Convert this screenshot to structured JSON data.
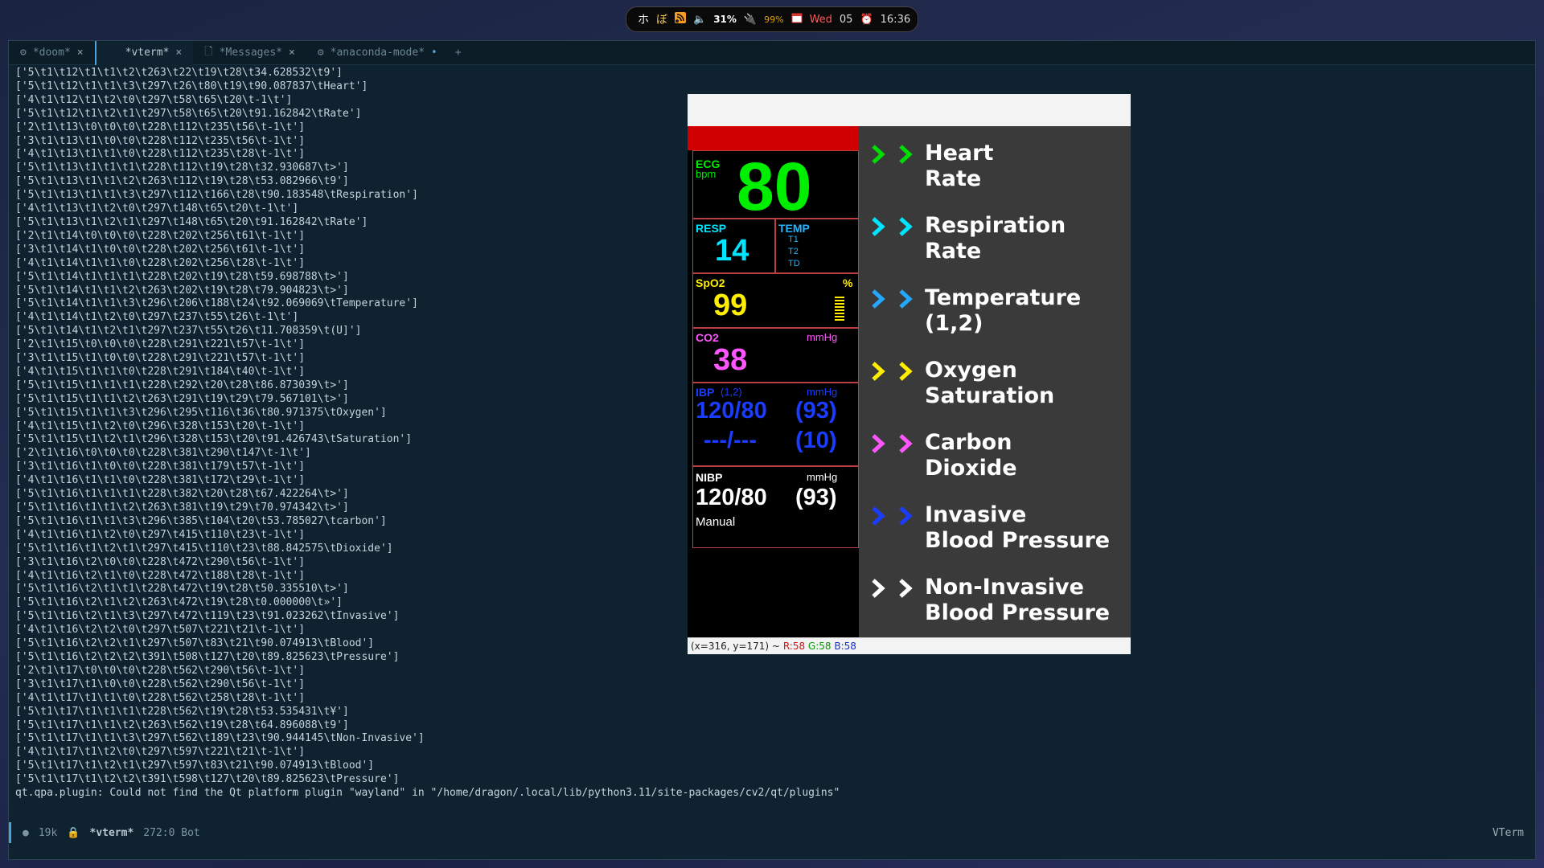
{
  "topbar": {
    "jp1": "ホ",
    "jp2": "ぼ",
    "volume": "31%",
    "battery": "99%",
    "day": "Wed",
    "date": "05",
    "time": "16:36"
  },
  "tabs": [
    {
      "label": "*doom*"
    },
    {
      "label": "*vterm*"
    },
    {
      "label": "*Messages*"
    },
    {
      "label": "*anaconda-mode*"
    }
  ],
  "terminal_lines": [
    "['5\\t1\\t12\\t1\\t1\\t2\\t263\\t22\\t19\\t28\\t34.628532\\t9']",
    "['5\\t1\\t12\\t1\\t1\\t3\\t297\\t26\\t80\\t19\\t90.087837\\tHeart']",
    "['4\\t1\\t12\\t1\\t2\\t0\\t297\\t58\\t65\\t20\\t-1\\t']",
    "['5\\t1\\t12\\t1\\t2\\t1\\t297\\t58\\t65\\t20\\t91.162842\\tRate']",
    "['2\\t1\\t13\\t0\\t0\\t0\\t228\\t112\\t235\\t56\\t-1\\t']",
    "['3\\t1\\t13\\t1\\t0\\t0\\t228\\t112\\t235\\t56\\t-1\\t']",
    "['4\\t1\\t13\\t1\\t1\\t0\\t228\\t112\\t235\\t28\\t-1\\t']",
    "['5\\t1\\t13\\t1\\t1\\t1\\t228\\t112\\t19\\t28\\t32.930687\\t>']",
    "['5\\t1\\t13\\t1\\t1\\t2\\t263\\t112\\t19\\t28\\t53.082966\\t9']",
    "['5\\t1\\t13\\t1\\t1\\t3\\t297\\t112\\t166\\t28\\t90.183548\\tRespiration']",
    "['4\\t1\\t13\\t1\\t2\\t0\\t297\\t148\\t65\\t20\\t-1\\t']",
    "['5\\t1\\t13\\t1\\t2\\t1\\t297\\t148\\t65\\t20\\t91.162842\\tRate']",
    "['2\\t1\\t14\\t0\\t0\\t0\\t228\\t202\\t256\\t61\\t-1\\t']",
    "['3\\t1\\t14\\t1\\t0\\t0\\t228\\t202\\t256\\t61\\t-1\\t']",
    "['4\\t1\\t14\\t1\\t1\\t0\\t228\\t202\\t256\\t28\\t-1\\t']",
    "['5\\t1\\t14\\t1\\t1\\t1\\t228\\t202\\t19\\t28\\t59.698788\\t>']",
    "['5\\t1\\t14\\t1\\t1\\t2\\t263\\t202\\t19\\t28\\t79.904823\\t>']",
    "['5\\t1\\t14\\t1\\t1\\t3\\t296\\t206\\t188\\t24\\t92.069069\\tTemperature']",
    "['4\\t1\\t14\\t1\\t2\\t0\\t297\\t237\\t55\\t26\\t-1\\t']",
    "['5\\t1\\t14\\t1\\t2\\t1\\t297\\t237\\t55\\t26\\t11.708359\\t(U]']",
    "['2\\t1\\t15\\t0\\t0\\t0\\t228\\t291\\t221\\t57\\t-1\\t']",
    "['3\\t1\\t15\\t1\\t0\\t0\\t228\\t291\\t221\\t57\\t-1\\t']",
    "['4\\t1\\t15\\t1\\t1\\t0\\t228\\t291\\t184\\t40\\t-1\\t']",
    "['5\\t1\\t15\\t1\\t1\\t1\\t228\\t292\\t20\\t28\\t86.873039\\t>']",
    "['5\\t1\\t15\\t1\\t1\\t2\\t263\\t291\\t19\\t29\\t79.567101\\t>']",
    "['5\\t1\\t15\\t1\\t1\\t3\\t296\\t295\\t116\\t36\\t80.971375\\tOxygen']",
    "['4\\t1\\t15\\t1\\t2\\t0\\t296\\t328\\t153\\t20\\t-1\\t']",
    "['5\\t1\\t15\\t1\\t2\\t1\\t296\\t328\\t153\\t20\\t91.426743\\tSaturation']",
    "['2\\t1\\t16\\t0\\t0\\t0\\t228\\t381\\t290\\t147\\t-1\\t']",
    "['3\\t1\\t16\\t1\\t0\\t0\\t228\\t381\\t179\\t57\\t-1\\t']",
    "['4\\t1\\t16\\t1\\t1\\t0\\t228\\t381\\t172\\t29\\t-1\\t']",
    "['5\\t1\\t16\\t1\\t1\\t1\\t228\\t382\\t20\\t28\\t67.422264\\t>']",
    "['5\\t1\\t16\\t1\\t1\\t2\\t263\\t381\\t19\\t29\\t70.974342\\t>']",
    "['5\\t1\\t16\\t1\\t1\\t3\\t296\\t385\\t104\\t20\\t53.785027\\tcarbon']",
    "['4\\t1\\t16\\t1\\t2\\t0\\t297\\t415\\t110\\t23\\t-1\\t']",
    "['5\\t1\\t16\\t1\\t2\\t1\\t297\\t415\\t110\\t23\\t88.842575\\tDioxide']",
    "['3\\t1\\t16\\t2\\t0\\t0\\t228\\t472\\t290\\t56\\t-1\\t']",
    "['4\\t1\\t16\\t2\\t1\\t0\\t228\\t472\\t188\\t28\\t-1\\t']",
    "['5\\t1\\t16\\t2\\t1\\t1\\t228\\t472\\t19\\t28\\t50.335510\\t>']",
    "['5\\t1\\t16\\t2\\t1\\t2\\t263\\t472\\t19\\t28\\t0.000000\\t»']",
    "['5\\t1\\t16\\t2\\t1\\t3\\t297\\t472\\t119\\t23\\t91.023262\\tInvasive']",
    "['4\\t1\\t16\\t2\\t2\\t0\\t297\\t507\\t221\\t21\\t-1\\t']",
    "['5\\t1\\t16\\t2\\t2\\t1\\t297\\t507\\t83\\t21\\t90.074913\\tBlood']",
    "['5\\t1\\t16\\t2\\t2\\t2\\t391\\t508\\t127\\t20\\t89.825623\\tPressure']",
    "['2\\t1\\t17\\t0\\t0\\t0\\t228\\t562\\t290\\t56\\t-1\\t']",
    "['3\\t1\\t17\\t1\\t0\\t0\\t228\\t562\\t290\\t56\\t-1\\t']",
    "['4\\t1\\t17\\t1\\t1\\t0\\t228\\t562\\t258\\t28\\t-1\\t']",
    "['5\\t1\\t17\\t1\\t1\\t1\\t228\\t562\\t19\\t28\\t53.535431\\t¥']",
    "['5\\t1\\t17\\t1\\t1\\t2\\t263\\t562\\t19\\t28\\t64.896088\\t9']",
    "['5\\t1\\t17\\t1\\t1\\t3\\t297\\t562\\t189\\t23\\t90.944145\\tNon-Invasive']",
    "['4\\t1\\t17\\t1\\t2\\t0\\t297\\t597\\t221\\t21\\t-1\\t']",
    "['5\\t1\\t17\\t1\\t2\\t1\\t297\\t597\\t83\\t21\\t90.074913\\tBlood']",
    "['5\\t1\\t17\\t1\\t2\\t2\\t391\\t598\\t127\\t20\\t89.825623\\tPressure']",
    "qt.qpa.plugin: Could not find the Qt platform plugin \"wayland\" in \"/home/dragon/.local/lib/python3.11/site-packages/cv2/qt/plugins\""
  ],
  "modeline": {
    "size": "19k",
    "buffer": "*vterm*",
    "position": "272:0 Bot",
    "mode": "VTerm"
  },
  "popup_status": {
    "coords": "(x=316, y=171) ~",
    "r": "R:58",
    "g": "G:58",
    "b": "B:58"
  },
  "monitor": {
    "ecg_label": "ECG",
    "ecg_unit": "bpm",
    "heart_rate": "80",
    "resp_label": "RESP",
    "resp_value": "14",
    "temp_label": "TEMP",
    "temp_t1": "T1",
    "temp_t2": "T2",
    "temp_td": "TD",
    "spo2_label": "SpO2",
    "spo2_unit": "%",
    "spo2_value": "99",
    "co2_label": "CO2",
    "co2_unit": "mmHg",
    "co2_value": "38",
    "ibp_label": "IBP",
    "ibp_channels": "(1,2)",
    "ibp_unit": "mmHg",
    "ibp_value1": "120/80",
    "ibp_mean1": "(93)",
    "ibp_value2": "---/---",
    "ibp_mean2": "(10)",
    "nibp_label": "NIBP",
    "nibp_unit": "mmHg",
    "nibp_value": "120/80",
    "nibp_mean": "(93)",
    "nibp_mode": "Manual"
  },
  "legend": [
    {
      "line1": "Heart",
      "line2": "Rate",
      "color": "#00dd00"
    },
    {
      "line1": "Respiration",
      "line2": "Rate",
      "color": "#00e5ff"
    },
    {
      "line1": "Temperature",
      "line2": "(1,2)",
      "color": "#22a8ff"
    },
    {
      "line1": "Oxygen",
      "line2": "Saturation",
      "color": "#ffee00"
    },
    {
      "line1": "Carbon",
      "line2": "Dioxide",
      "color": "#ff55ff"
    },
    {
      "line1": "Invasive",
      "line2": "Blood Pressure",
      "color": "#1a3cff"
    },
    {
      "line1": "Non-Invasive",
      "line2": "Blood Pressure",
      "color": "#ffffff"
    }
  ]
}
